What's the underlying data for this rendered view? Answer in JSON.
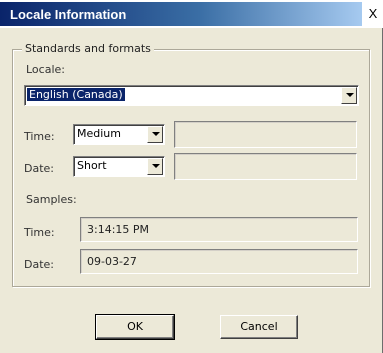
{
  "window": {
    "title": "Locale Information",
    "close_label": "X"
  },
  "group": {
    "title": "Standards and formats"
  },
  "locale": {
    "label": "Locale:",
    "selected": "English (Canada)"
  },
  "time_format": {
    "label": "Time:",
    "selected": "Medium"
  },
  "date_format": {
    "label": "Date:",
    "selected": "Short"
  },
  "samples": {
    "label": "Samples:",
    "time_label": "Time:",
    "time_value": "3:14:15 PM",
    "date_label": "Date:",
    "date_value": "09-03-27"
  },
  "buttons": {
    "ok": "OK",
    "cancel": "Cancel"
  }
}
